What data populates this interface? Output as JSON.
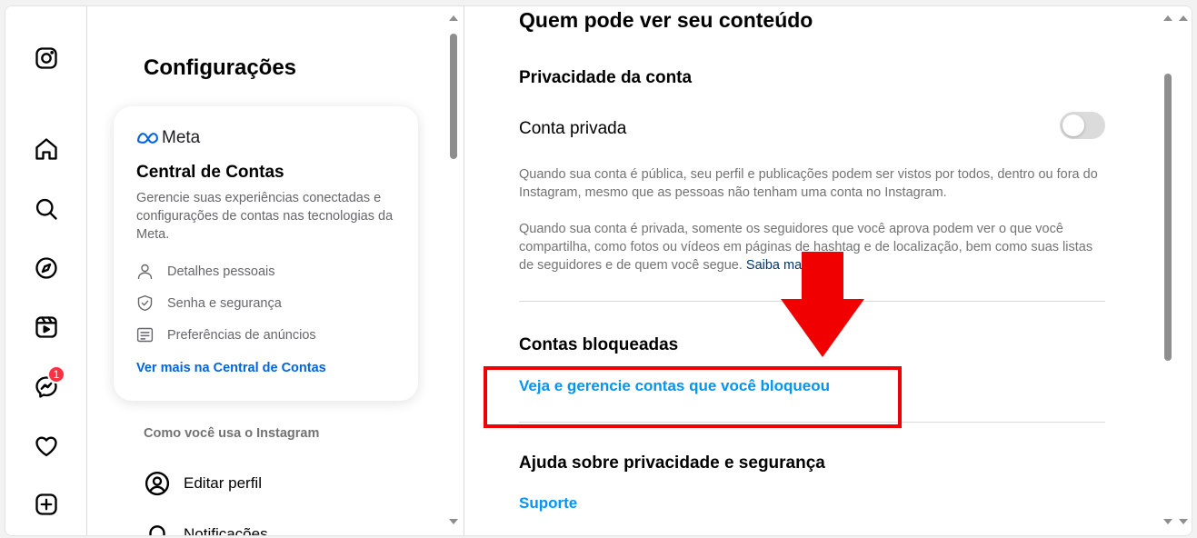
{
  "nav": {
    "messages_badge": "1"
  },
  "settings": {
    "title": "Configurações",
    "accounts_center": {
      "brand": "Meta",
      "title": "Central de Contas",
      "description": "Gerencie suas experiências conectadas e configurações de contas nas tecnologias da Meta.",
      "items": [
        "Detalhes pessoais",
        "Senha e segurança",
        "Preferências de anúncios"
      ],
      "link": "Ver mais na Central de Contas"
    },
    "section_label": "Como você usa o Instagram",
    "items": [
      "Editar perfil",
      "Notificações"
    ]
  },
  "content": {
    "title": "Quem pode ver seu conteúdo",
    "account_privacy": {
      "heading": "Privacidade da conta",
      "private_label": "Conta privada",
      "private_enabled": false,
      "para1": "Quando sua conta é pública, seu perfil e publicações podem ser vistos por todos, dentro ou fora do Instagram, mesmo que as pessoas não tenham uma conta no Instagram.",
      "para2": "Quando sua conta é privada, somente os seguidores que você aprova podem ver o que você compartilha, como fotos ou vídeos em páginas de hashtag e de localização, bem como suas listas de seguidores e de quem você segue.",
      "learn_more": "Saiba mais"
    },
    "blocked": {
      "heading": "Contas bloqueadas",
      "link": "Veja e gerencie contas que você bloqueou"
    },
    "help": {
      "heading": "Ajuda sobre privacidade e segurança",
      "link": "Suporte"
    }
  },
  "colors": {
    "annotation_red": "#f00000",
    "link_blue": "#0095f6",
    "meta_blue": "#0064e0",
    "badge_red": "#ff3040"
  },
  "icons": {
    "nav": [
      "instagram-logo-icon",
      "home-icon",
      "search-icon",
      "explore-icon",
      "reels-icon",
      "messenger-icon",
      "heart-icon",
      "create-icon"
    ]
  }
}
